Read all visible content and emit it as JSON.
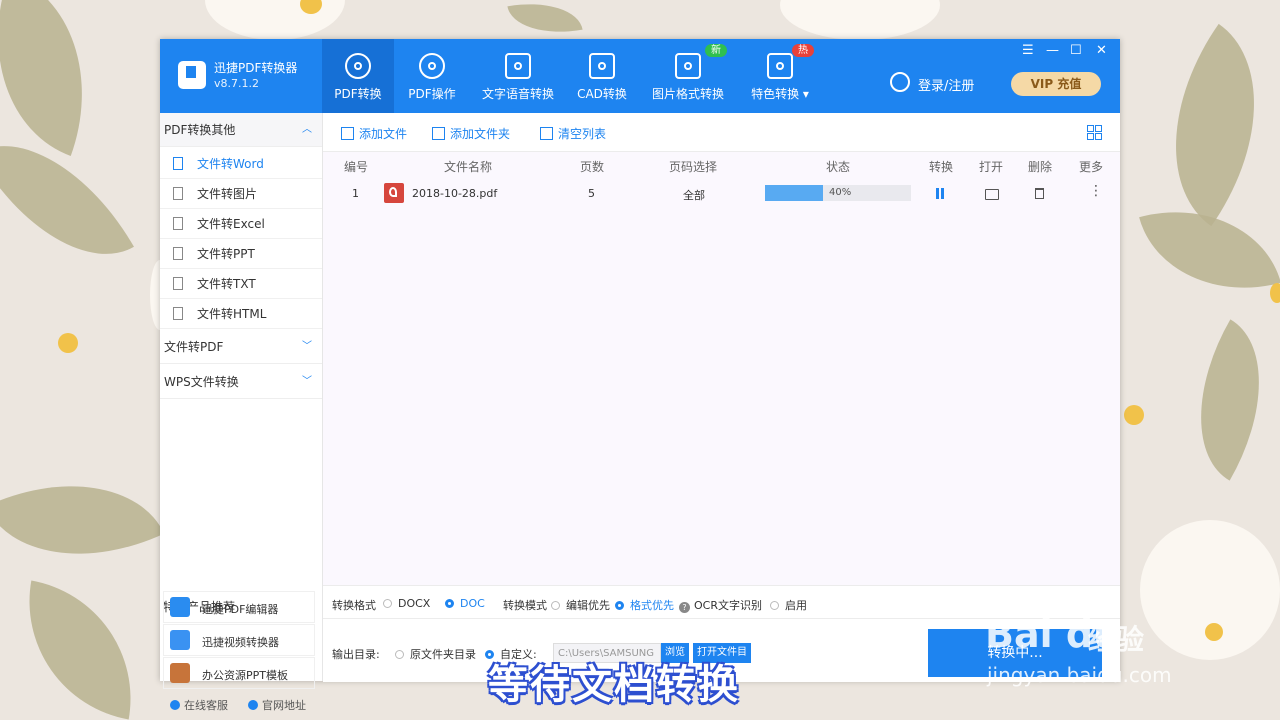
{
  "app": {
    "name": "迅捷PDF转换器",
    "version": "v8.7.1.2"
  },
  "nav": {
    "tabs": [
      {
        "label": "PDF转换",
        "active": true
      },
      {
        "label": "PDF操作"
      },
      {
        "label": "文字语音转换"
      },
      {
        "label": "CAD转换"
      },
      {
        "label": "图片格式转换",
        "badge": "新"
      },
      {
        "label": "特色转换 ▾",
        "badge": "热"
      }
    ],
    "login": "登录/注册",
    "vip": "VIP 充值",
    "window_controls": [
      "☰",
      "—",
      "☐",
      "✕"
    ]
  },
  "sidebar": {
    "sections": [
      {
        "label": "PDF转换其他",
        "chevron": "︿",
        "items": [
          "文件转Word",
          "文件转图片",
          "文件转Excel",
          "文件转PPT",
          "文件转TXT",
          "文件转HTML"
        ]
      },
      {
        "label": "文件转PDF",
        "chevron": "﹀"
      },
      {
        "label": "WPS文件转换",
        "chevron": "﹀"
      }
    ],
    "recommend_title": "特色产品推荐",
    "recommend": [
      "迅捷PDF编辑器",
      "迅捷视频转换器",
      "办公资源PPT模板"
    ],
    "footer": [
      "在线客服",
      "官网地址"
    ]
  },
  "toolbar": {
    "add_file": "添加文件",
    "add_folder": "添加文件夹",
    "clear_list": "清空列表"
  },
  "table": {
    "headers": [
      "编号",
      "文件名称",
      "页数",
      "页码选择",
      "状态",
      "转换",
      "打开",
      "删除",
      "更多"
    ],
    "rows": [
      {
        "index": "1",
        "filename": "2018-10-28.pdf",
        "pages": "5",
        "range": "全部",
        "progress": 0.4,
        "progress_text": "40%",
        "more": "⋮"
      }
    ]
  },
  "options": {
    "format_label": "转换格式",
    "formats": [
      "DOCX",
      "DOC"
    ],
    "mode_label": "转换模式",
    "modes": [
      "编辑优先",
      "格式优先"
    ],
    "ocr_label": "OCR文字识别",
    "ocr_help": "?",
    "ocr_enable": "启用"
  },
  "output": {
    "label": "输出目录:",
    "original": "原文件夹目录",
    "custom": "自定义:",
    "path": "C:\\Users\\SAMSUNG",
    "path_btn": "浏览",
    "open_btn": "打开文件目",
    "convert_btn": "转换中..."
  },
  "subtitle": "等待文档转换",
  "watermark": {
    "logo": "Bai du",
    "cn": "经验",
    "url": "jingyan.baidu.com"
  }
}
